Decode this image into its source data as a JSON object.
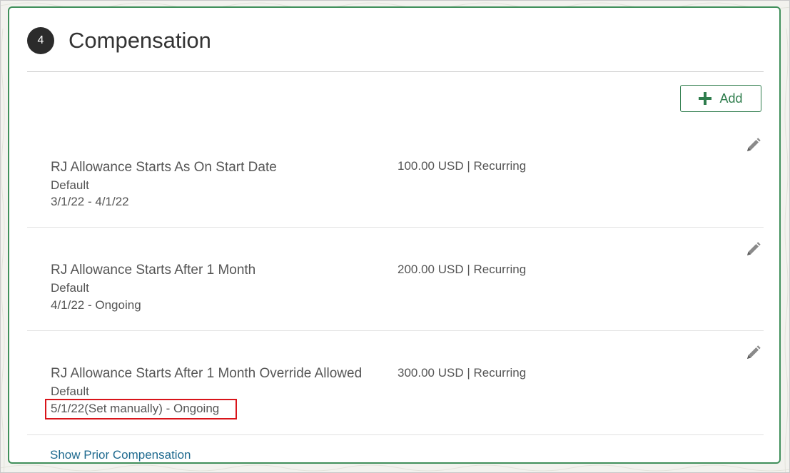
{
  "section": {
    "step_number": "4",
    "title": "Compensation"
  },
  "toolbar": {
    "add_label": "Add"
  },
  "compensation_items": [
    {
      "name": "RJ Allowance Starts As On Start Date",
      "plan": "Default",
      "dates": "3/1/22 - 4/1/22",
      "amount": "100.00 USD | Recurring"
    },
    {
      "name": "RJ Allowance Starts After 1 Month",
      "plan": "Default",
      "dates": "4/1/22 - Ongoing",
      "amount": "200.00 USD | Recurring"
    },
    {
      "name": "RJ Allowance Starts After 1 Month Override Allowed",
      "plan": "Default",
      "dates": "5/1/22(Set manually) - Ongoing",
      "amount": "300.00 USD | Recurring"
    }
  ],
  "footer": {
    "show_prior_label": "Show Prior Compensation"
  },
  "icons": {
    "add": "plus-icon",
    "edit": "pencil-icon"
  },
  "colors": {
    "accent_green": "#2f7d4d",
    "card_border": "#3f8f5a",
    "link_blue": "#1f6a8f",
    "highlight_red": "#d9141a"
  }
}
